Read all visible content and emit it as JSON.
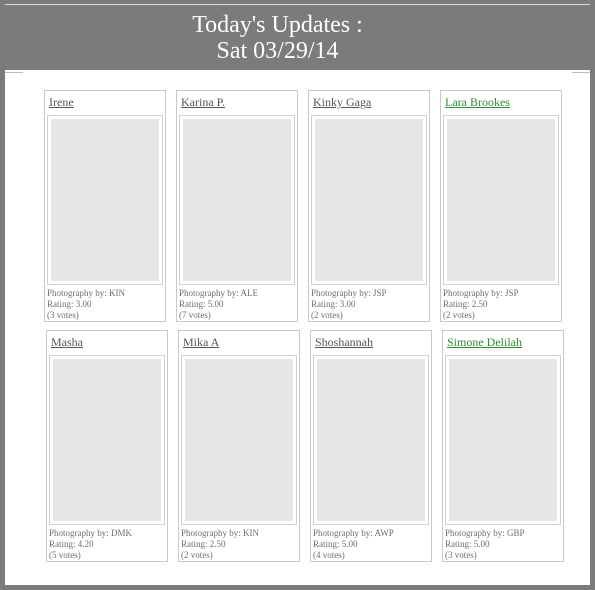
{
  "header": {
    "title_line1": "Today's Updates :",
    "title_line2": "Sat 03/29/14"
  },
  "cards": [
    {
      "name": "Irene",
      "name_color": "#555555",
      "photography": "Photography by: KIN",
      "rating": "Rating: 3.00",
      "votes": "(3 votes)"
    },
    {
      "name": "Karina P.",
      "name_color": "#555555",
      "photography": "Photography by: ALE",
      "rating": "Rating: 5.00",
      "votes": "(7 votes)"
    },
    {
      "name": "Kinky Gaga",
      "name_color": "#555555",
      "photography": "Photography by: JSP",
      "rating": "Rating: 3.00",
      "votes": "(2 votes)"
    },
    {
      "name": "Lara Brookes",
      "name_color": "#2e8b2e",
      "photography": "Photography by: JSP",
      "rating": "Rating: 2.50",
      "votes": "(2 votes)"
    },
    {
      "name": "Masha",
      "name_color": "#555555",
      "photography": "Photography by: DMK",
      "rating": "Rating: 4.20",
      "votes": "(5 votes)"
    },
    {
      "name": "Mika A",
      "name_color": "#555555",
      "photography": "Photography by: KIN",
      "rating": "Rating: 2.50",
      "votes": "(2 votes)"
    },
    {
      "name": "Shoshannah",
      "name_color": "#555555",
      "photography": "Photography by: AWP",
      "rating": "Rating: 5.00",
      "votes": "(4 votes)"
    },
    {
      "name": "Simone Delilah",
      "name_color": "#2e8b2e",
      "photography": "Photography by: GBP",
      "rating": "Rating: 5.00",
      "votes": "(3 votes)"
    }
  ]
}
